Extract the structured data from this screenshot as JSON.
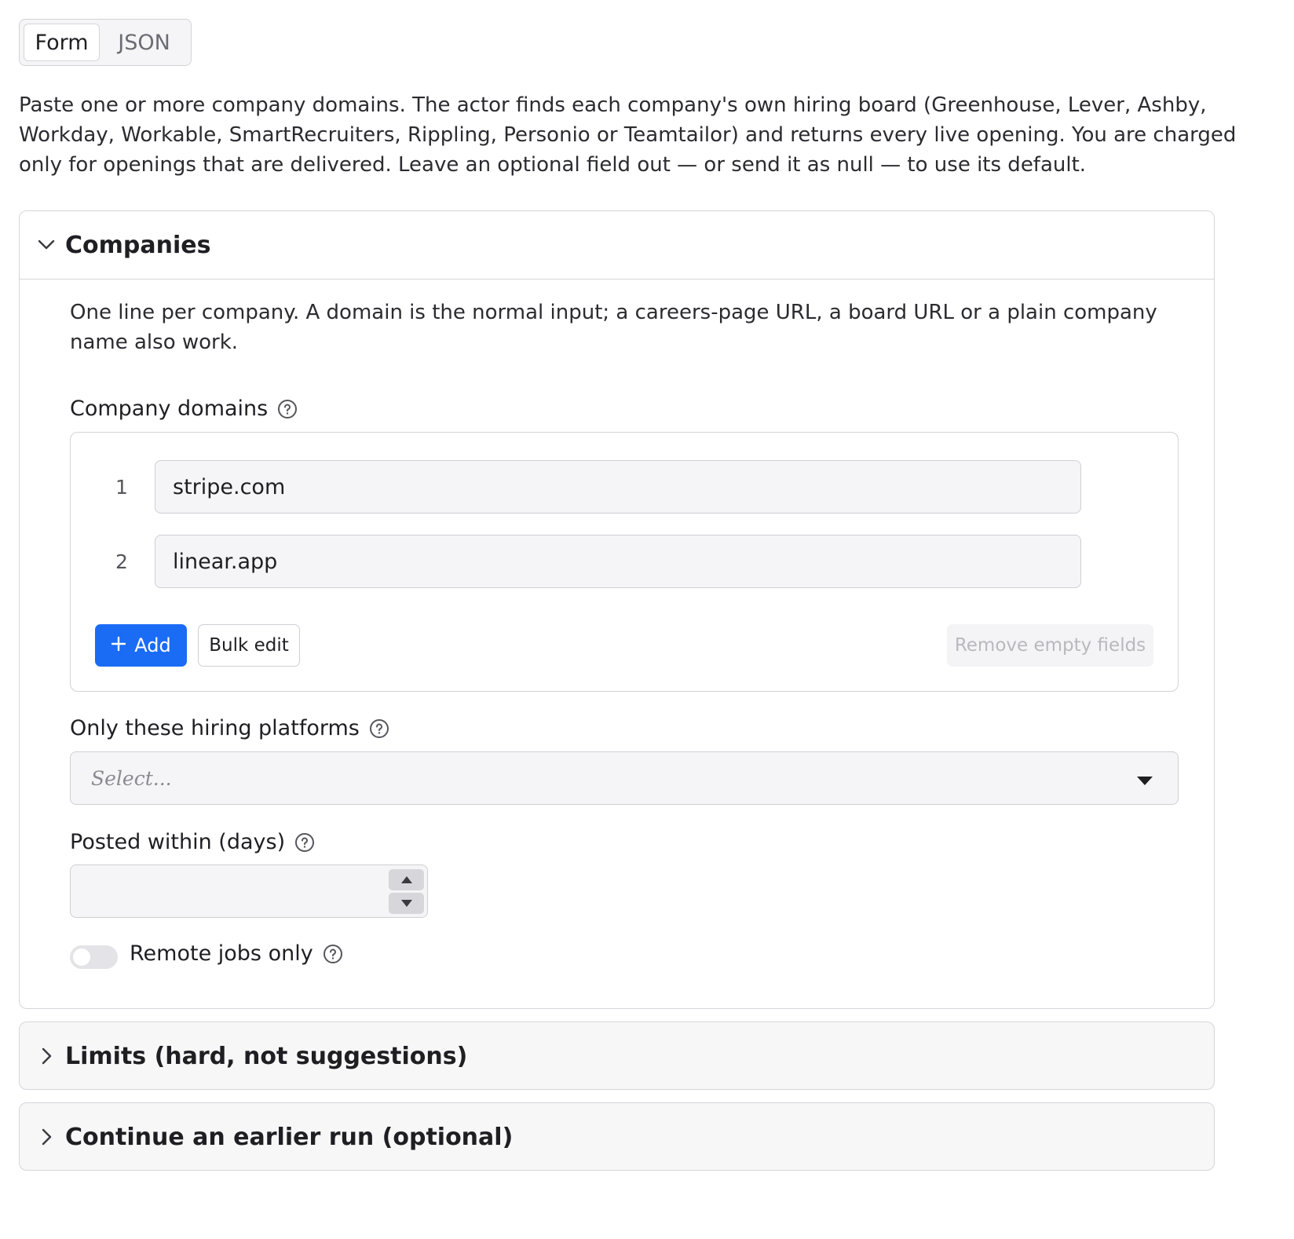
{
  "mode_tabs": {
    "form": "Form",
    "json": "JSON"
  },
  "intro": "Paste one or more company domains. The actor finds each company's own hiring board (Greenhouse, Lever, Ashby, Workday, Workable, SmartRecruiters, Rippling, Personio or Teamtailor) and returns every live opening. You are charged only for openings that are delivered. Leave an optional field out — or send it as null — to use its default.",
  "companies": {
    "title": "Companies",
    "description": "One line per company. A domain is the normal input; a careers-page URL, a board URL or a plain company name also work.",
    "domains_label": "Company domains",
    "domains": [
      {
        "index": "1",
        "value": "stripe.com"
      },
      {
        "index": "2",
        "value": "linear.app"
      }
    ],
    "add_label": "Add",
    "bulk_edit_label": "Bulk edit",
    "remove_empty_label": "Remove empty fields",
    "platforms_label": "Only these hiring platforms",
    "platforms_placeholder": "Select...",
    "posted_within_label": "Posted within (days)",
    "posted_within_value": "",
    "remote_only_label": "Remote jobs only",
    "remote_only_enabled": false
  },
  "sections": {
    "limits_title": "Limits (hard, not suggestions)",
    "continue_title": "Continue an earlier run (optional)"
  },
  "colors": {
    "primary": "#1a6cf5",
    "border": "#d6d6db",
    "input_bg": "#f5f5f7"
  }
}
